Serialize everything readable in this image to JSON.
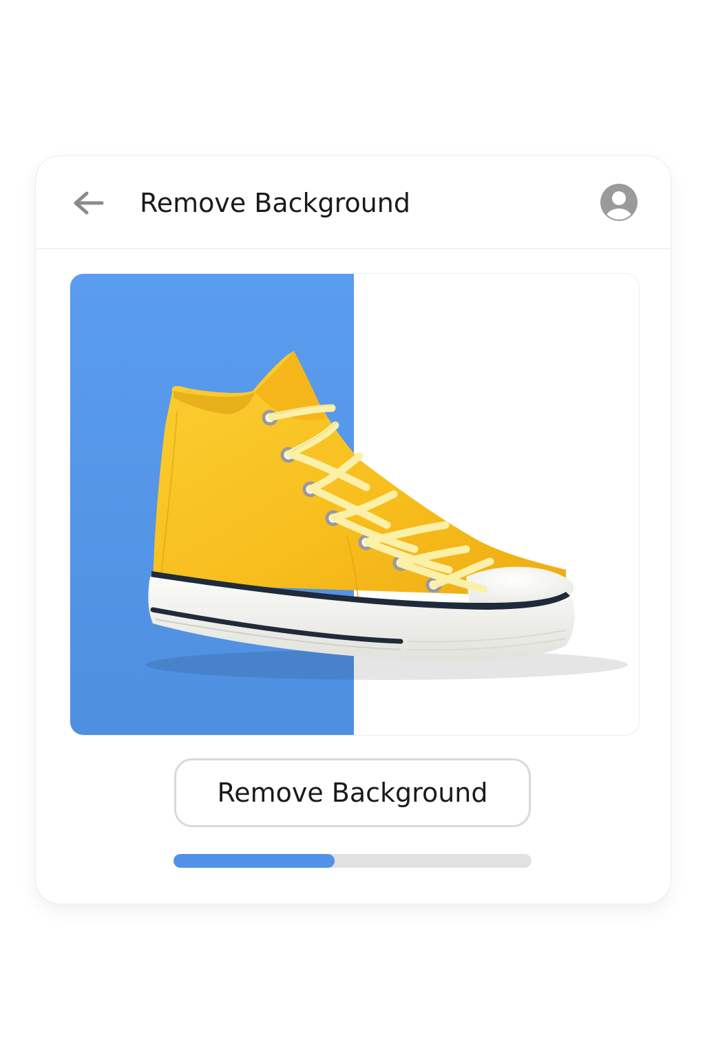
{
  "header": {
    "title": "Remove Background",
    "back_icon": "arrow-left-icon",
    "account_icon": "account-circle-icon"
  },
  "preview": {
    "original_background_color": "#5599EC",
    "removed_background_color": "#FFFFFF",
    "subject": "yellow high-top sneaker"
  },
  "action": {
    "button_label": "Remove Background"
  },
  "progress": {
    "value": 0.45
  },
  "colors": {
    "accent": "#4F92E8",
    "track": "#E1E1E1",
    "shoe_canvas": "#F9C21E",
    "laces": "#FBF0A8",
    "sole_stripe": "#1F2A3A"
  }
}
